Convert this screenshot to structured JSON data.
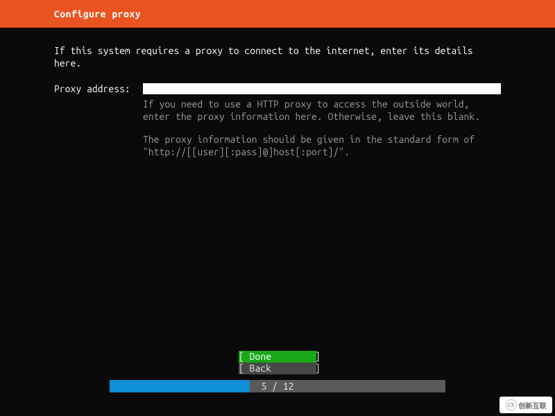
{
  "header": {
    "title": "Configure proxy"
  },
  "main": {
    "intro": "If this system requires a proxy to connect to the internet, enter its details here.",
    "proxy_label": "Proxy address:",
    "proxy_value": "",
    "help_para1": "If you need to use a HTTP proxy to access the outside world, enter the proxy information here. Otherwise, leave this blank.",
    "help_para2": "The proxy information should be given in the standard form of \"http://[[user][:pass]@]host[:port]/\"."
  },
  "buttons": {
    "done": "[ Done        ]",
    "back": "[ Back        ]"
  },
  "progress": {
    "current": 5,
    "total": 12,
    "text": "5 / 12",
    "percent": 41.67
  },
  "watermark": {
    "icon": "CX",
    "text": "创新互联"
  }
}
